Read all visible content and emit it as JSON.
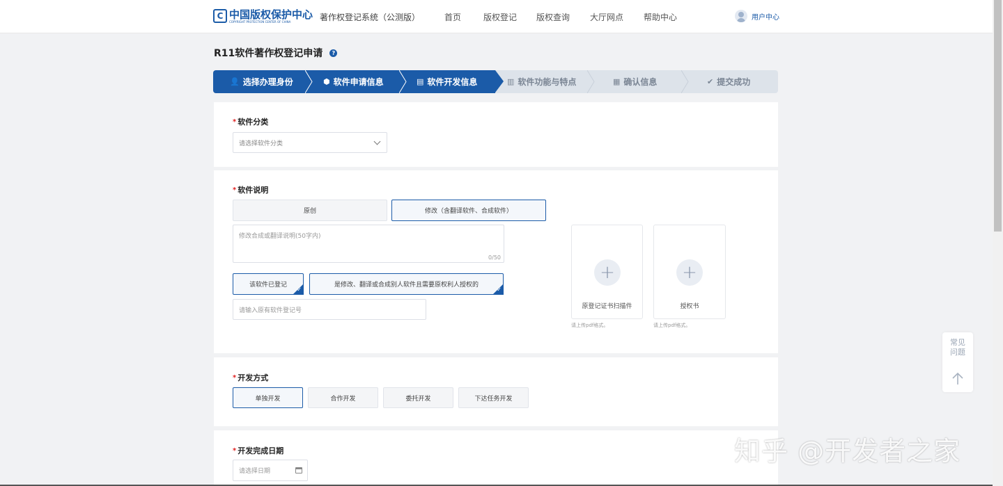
{
  "header": {
    "logo_cn": "中国版权保护中心",
    "logo_en": "COPYRIGHT PROTECTION CENTER OF CHINA",
    "logo_mark": "C",
    "system_name": "著作权登记系统（公测版）",
    "nav": [
      "首页",
      "版权登记",
      "版权查询",
      "大厅网点",
      "帮助中心"
    ],
    "user_center": "用户中心"
  },
  "page": {
    "title": "R11软件著作权登记申请",
    "help_glyph": "?"
  },
  "steps": [
    {
      "label": "选择办理身份",
      "icon": "user-icon",
      "glyph": "👤",
      "state": "done"
    },
    {
      "label": "软件申请信息",
      "icon": "location-icon",
      "glyph": "⬢",
      "state": "done"
    },
    {
      "label": "软件开发信息",
      "icon": "grid-icon",
      "glyph": "▤",
      "state": "current"
    },
    {
      "label": "软件功能与特点",
      "icon": "document-icon",
      "glyph": "▥",
      "state": "todo"
    },
    {
      "label": "确认信息",
      "icon": "clipboard-icon",
      "glyph": "▦",
      "state": "todo"
    },
    {
      "label": "提交成功",
      "icon": "check-circle-icon",
      "glyph": "✔",
      "state": "todo"
    }
  ],
  "category_section": {
    "required_mark": "*",
    "label": "软件分类",
    "select_placeholder": "请选择软件分类"
  },
  "description_section": {
    "required_mark": "*",
    "label": "软件说明",
    "options": [
      "原创",
      "修改（含翻译软件、合成软件）"
    ],
    "selected_option": "修改（含翻译软件、合成软件）",
    "textarea_placeholder": "修改合成或翻译说明(50字内)",
    "char_counter": "0/50",
    "check_options": [
      "该软件已登记",
      "是修改、翻译或合成别人软件且需要原权利人授权的"
    ],
    "registration_input_placeholder": "请输入原有软件登记号",
    "uploads": [
      {
        "label": "原登记证书扫描件",
        "hint": "请上传pdf格式。"
      },
      {
        "label": "授权书",
        "hint": "请上传pdf格式。"
      }
    ]
  },
  "dev_mode_section": {
    "required_mark": "*",
    "label": "开发方式",
    "options": [
      "单独开发",
      "合作开发",
      "委托开发",
      "下达任务开发"
    ],
    "selected_option": "单独开发"
  },
  "completion_date_section": {
    "required_mark": "*",
    "label": "开发完成日期",
    "date_placeholder": "请选择日期"
  },
  "float_widget": {
    "faq_line1": "常见",
    "faq_line2": "问题"
  },
  "watermark": "知乎 @开发者之家",
  "colors": {
    "primary": "#1b5ba8",
    "required": "#e02020",
    "background": "#f1f2f4"
  }
}
